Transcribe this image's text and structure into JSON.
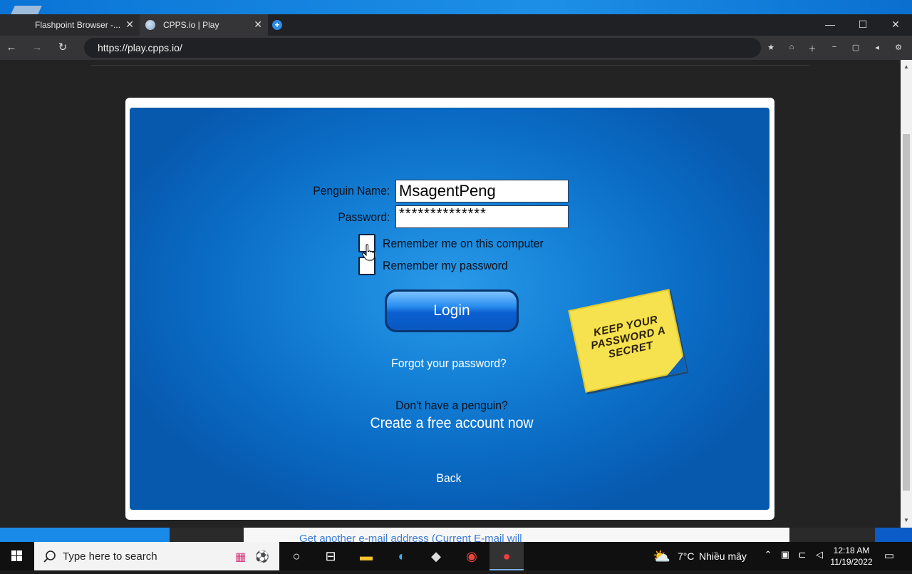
{
  "browser": {
    "tabs": [
      {
        "label": "Flashpoint Browser -...",
        "close": "✕"
      },
      {
        "label": "CPPS.io | Play",
        "close": "✕"
      }
    ],
    "url": "https://play.cpps.io/",
    "window_controls": {
      "minimize": "—",
      "maximize": "☐",
      "close": "✕"
    }
  },
  "login": {
    "penguin_name_label": "Penguin Name:",
    "penguin_name_value": "MsagentPeng",
    "password_label": "Password:",
    "password_value": "**************",
    "remember_computer": {
      "label": "Remember me on this computer",
      "checked": false
    },
    "remember_password": {
      "label": "Remember my password",
      "checked": false
    },
    "login_button": "Login",
    "forgot_password": "Forgot your password?",
    "no_penguin": "Don't have a penguin?",
    "create_account": "Create a free account now",
    "back": "Back",
    "sticky_note": "KEEP YOUR PASSWORD A SECRET"
  },
  "background_page": {
    "partial_text": "Get another e-mail address (Current E-mail will"
  },
  "taskbar": {
    "search_placeholder": "Type here to search",
    "weather": {
      "temp": "7°C",
      "condition": "Nhiều mây"
    },
    "clock": {
      "time": "12:18 AM",
      "date": "11/19/2022"
    }
  },
  "colors": {
    "panel_blue": "#1683d8",
    "sticky_yellow": "#f6e14e",
    "button_blue": "#2a8ef0"
  }
}
